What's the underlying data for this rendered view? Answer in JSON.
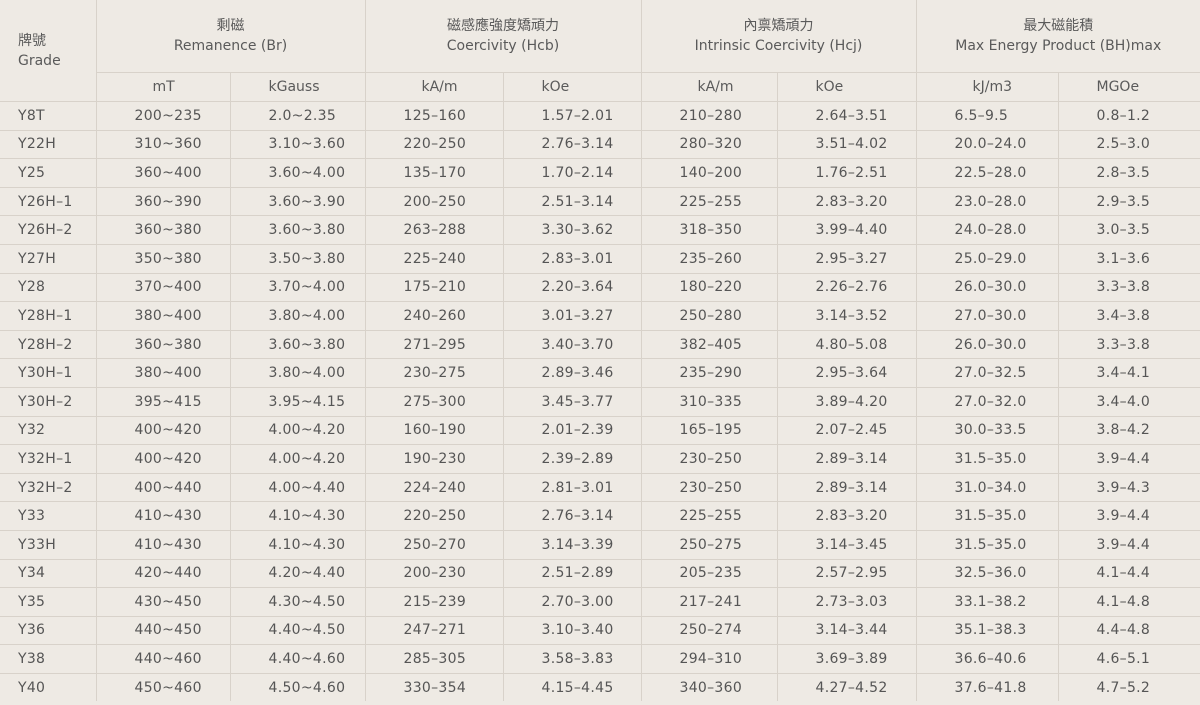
{
  "header": {
    "grade": {
      "zh": "牌號",
      "en": "Grade"
    },
    "groups": [
      {
        "zh": "剩磁",
        "en": "Remanence (Br)",
        "units": [
          "mT",
          "kGauss"
        ]
      },
      {
        "zh": "磁感應強度矯頑力",
        "en": "Coercivity (Hcb)",
        "units": [
          "kA/m",
          "kOe"
        ]
      },
      {
        "zh": "內禀矯頑力",
        "en": "Intrinsic Coercivity (Hcj)",
        "units": [
          "kA/m",
          "kOe"
        ]
      },
      {
        "zh": "最大磁能積",
        "en": "Max Energy Product (BH)max",
        "units": [
          "kJ/m3",
          "MGOe"
        ]
      }
    ]
  },
  "rows": [
    [
      "Y8T",
      "200~235",
      "2.0~2.35",
      "125–160",
      "1.57–2.01",
      "210–280",
      "2.64–3.51",
      "6.5–9.5",
      "0.8–1.2"
    ],
    [
      "Y22H",
      "310~360",
      "3.10~3.60",
      "220–250",
      "2.76–3.14",
      "280–320",
      "3.51–4.02",
      "20.0–24.0",
      "2.5–3.0"
    ],
    [
      "Y25",
      "360~400",
      "3.60~4.00",
      "135–170",
      "1.70–2.14",
      "140–200",
      "1.76–2.51",
      "22.5–28.0",
      "2.8–3.5"
    ],
    [
      "Y26H–1",
      "360~390",
      "3.60~3.90",
      "200–250",
      "2.51–3.14",
      "225–255",
      "2.83–3.20",
      "23.0–28.0",
      "2.9–3.5"
    ],
    [
      "Y26H–2",
      "360~380",
      "3.60~3.80",
      "263–288",
      "3.30–3.62",
      "318–350",
      "3.99–4.40",
      "24.0–28.0",
      "3.0–3.5"
    ],
    [
      "Y27H",
      "350~380",
      "3.50~3.80",
      "225–240",
      "2.83–3.01",
      "235–260",
      "2.95–3.27",
      "25.0–29.0",
      "3.1–3.6"
    ],
    [
      "Y28",
      "370~400",
      "3.70~4.00",
      "175–210",
      "2.20–3.64",
      "180–220",
      "2.26–2.76",
      "26.0–30.0",
      "3.3–3.8"
    ],
    [
      "Y28H–1",
      "380~400",
      "3.80~4.00",
      "240–260",
      "3.01–3.27",
      "250–280",
      "3.14–3.52",
      "27.0–30.0",
      "3.4–3.8"
    ],
    [
      "Y28H–2",
      "360~380",
      "3.60~3.80",
      "271–295",
      "3.40–3.70",
      "382–405",
      "4.80–5.08",
      "26.0–30.0",
      "3.3–3.8"
    ],
    [
      "Y30H–1",
      "380~400",
      "3.80~4.00",
      "230–275",
      "2.89–3.46",
      "235–290",
      "2.95–3.64",
      "27.0–32.5",
      "3.4–4.1"
    ],
    [
      "Y30H–2",
      "395~415",
      "3.95~4.15",
      "275–300",
      "3.45–3.77",
      "310–335",
      "3.89–4.20",
      "27.0–32.0",
      "3.4–4.0"
    ],
    [
      "Y32",
      "400~420",
      "4.00~4.20",
      "160–190",
      "2.01–2.39",
      "165–195",
      "2.07–2.45",
      "30.0–33.5",
      "3.8–4.2"
    ],
    [
      "Y32H–1",
      "400~420",
      "4.00~4.20",
      "190–230",
      "2.39–2.89",
      "230–250",
      "2.89–3.14",
      "31.5–35.0",
      "3.9–4.4"
    ],
    [
      "Y32H–2",
      "400~440",
      "4.00~4.40",
      "224–240",
      "2.81–3.01",
      "230–250",
      "2.89–3.14",
      "31.0–34.0",
      "3.9–4.3"
    ],
    [
      "Y33",
      "410~430",
      "4.10~4.30",
      "220–250",
      "2.76–3.14",
      "225–255",
      "2.83–3.20",
      "31.5–35.0",
      "3.9–4.4"
    ],
    [
      "Y33H",
      "410~430",
      "4.10~4.30",
      "250–270",
      "3.14–3.39",
      "250–275",
      "3.14–3.45",
      "31.5–35.0",
      "3.9–4.4"
    ],
    [
      "Y34",
      "420~440",
      "4.20~4.40",
      "200–230",
      "2.51–2.89",
      "205–235",
      "2.57–2.95",
      "32.5–36.0",
      "4.1–4.4"
    ],
    [
      "Y35",
      "430~450",
      "4.30~4.50",
      "215–239",
      "2.70–3.00",
      "217–241",
      "2.73–3.03",
      "33.1–38.2",
      "4.1–4.8"
    ],
    [
      "Y36",
      "440~450",
      "4.40~4.50",
      "247–271",
      "3.10–3.40",
      "250–274",
      "3.14–3.44",
      "35.1–38.3",
      "4.4–4.8"
    ],
    [
      "Y38",
      "440~460",
      "4.40~4.60",
      "285–305",
      "3.58–3.83",
      "294–310",
      "3.69–3.89",
      "36.6–40.6",
      "4.6–5.1"
    ],
    [
      "Y40",
      "450~460",
      "4.50~4.60",
      "330–354",
      "4.15–4.45",
      "340–360",
      "4.27–4.52",
      "37.6–41.8",
      "4.7–5.2"
    ]
  ]
}
